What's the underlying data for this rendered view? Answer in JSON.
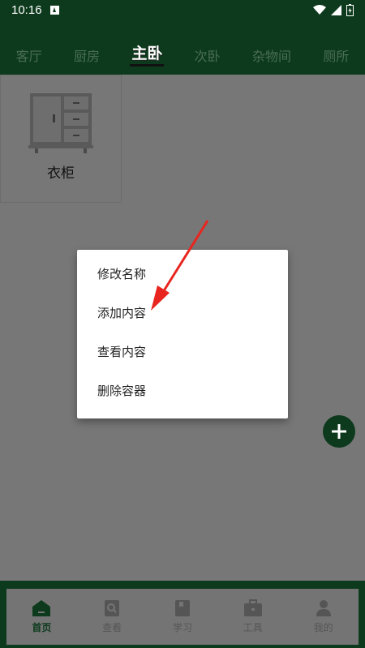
{
  "status_bar": {
    "time": "10:16"
  },
  "tabs": [
    {
      "label": "客厅"
    },
    {
      "label": "厨房"
    },
    {
      "label": "主卧",
      "active": true
    },
    {
      "label": "次卧"
    },
    {
      "label": "杂物间"
    },
    {
      "label": "厕所"
    }
  ],
  "container_card": {
    "label": "衣柜",
    "icon": "cabinet-icon"
  },
  "context_menu": {
    "items": [
      {
        "label": "修改名称"
      },
      {
        "label": "添加内容"
      },
      {
        "label": "查看内容"
      },
      {
        "label": "删除容器"
      }
    ]
  },
  "fab": {
    "icon": "plus-icon"
  },
  "bottom_nav": {
    "items": [
      {
        "label": "首页",
        "icon": "home-icon",
        "active": true
      },
      {
        "label": "查看",
        "icon": "search-doc-icon"
      },
      {
        "label": "学习",
        "icon": "book-icon"
      },
      {
        "label": "工具",
        "icon": "briefcase-icon"
      },
      {
        "label": "我的",
        "icon": "person-icon"
      }
    ]
  },
  "colors": {
    "primary": "#0d3a1d",
    "annotation_arrow": "#e8261f"
  }
}
